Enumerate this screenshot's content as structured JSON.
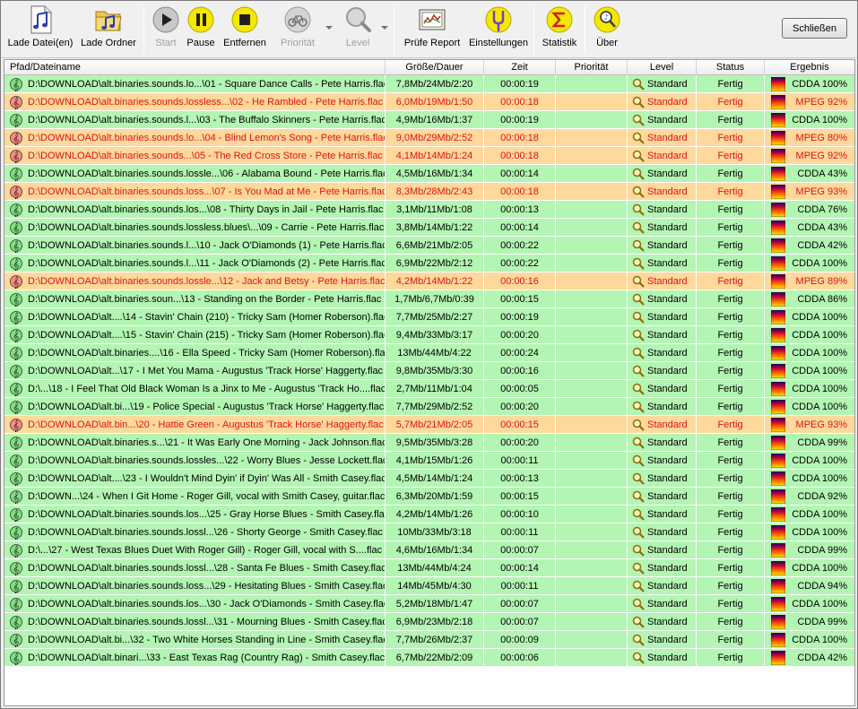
{
  "toolbar": {
    "load_file": "Lade Datei(en)",
    "load_folder": "Lade Ordner",
    "start": "Start",
    "pause": "Pause",
    "remove": "Entfernen",
    "priority": "Priorität",
    "level": "Level",
    "check_report": "Prüfe Report",
    "settings": "Einstellungen",
    "statistics": "Statistik",
    "about": "Über",
    "close": "Schließen"
  },
  "columns": {
    "path": "Pfad/Dateiname",
    "size": "Größe/Dauer",
    "time": "Zeit",
    "priority": "Priorität",
    "level": "Level",
    "status": "Status",
    "result": "Ergebnis"
  },
  "colors": {
    "ok_row": "#b3f5b3",
    "warn_row": "#ffd99b",
    "warn_text": "#e01010"
  },
  "rows": [
    {
      "path": "D:\\DOWNLOAD\\alt.binaries.sounds.lo...\\01 - Square Dance Calls - Pete Harris.flac",
      "size": "7,8Mb/24Mb/2:20",
      "time": "00:00:19",
      "level": "Standard",
      "status": "Fertig",
      "result": "CDDA 100%",
      "warn": false
    },
    {
      "path": "D:\\DOWNLOAD\\alt.binaries.sounds.lossless...\\02 - He Rambled - Pete Harris.flac",
      "size": "6,0Mb/19Mb/1:50",
      "time": "00:00:18",
      "level": "Standard",
      "status": "Fertig",
      "result": "MPEG 92%",
      "warn": true
    },
    {
      "path": "D:\\DOWNLOAD\\alt.binaries.sounds.l...\\03 - The Buffalo Skinners - Pete Harris.flac",
      "size": "4,9Mb/16Mb/1:37",
      "time": "00:00:19",
      "level": "Standard",
      "status": "Fertig",
      "result": "CDDA 100%",
      "warn": false
    },
    {
      "path": "D:\\DOWNLOAD\\alt.binaries.sounds.lo...\\04 - Blind Lemon's Song - Pete Harris.flac",
      "size": "9,0Mb/29Mb/2:52",
      "time": "00:00:18",
      "level": "Standard",
      "status": "Fertig",
      "result": "MPEG 80%",
      "warn": true
    },
    {
      "path": "D:\\DOWNLOAD\\alt.binaries.sounds...\\05 - The Red Cross Store - Pete Harris.flac",
      "size": "4,1Mb/14Mb/1:24",
      "time": "00:00:18",
      "level": "Standard",
      "status": "Fertig",
      "result": "MPEG 92%",
      "warn": true
    },
    {
      "path": "D:\\DOWNLOAD\\alt.binaries.sounds.lossle...\\06 - Alabama Bound - Pete Harris.flac",
      "size": "4,5Mb/16Mb/1:34",
      "time": "00:00:14",
      "level": "Standard",
      "status": "Fertig",
      "result": "CDDA 43%",
      "warn": false
    },
    {
      "path": "D:\\DOWNLOAD\\alt.binaries.sounds.loss...\\07 - Is You Mad at Me - Pete Harris.flac",
      "size": "8,3Mb/28Mb/2:43",
      "time": "00:00:18",
      "level": "Standard",
      "status": "Fertig",
      "result": "MPEG 93%",
      "warn": true
    },
    {
      "path": "D:\\DOWNLOAD\\alt.binaries.sounds.los...\\08 - Thirty Days in Jail - Pete Harris.flac",
      "size": "3,1Mb/11Mb/1:08",
      "time": "00:00:13",
      "level": "Standard",
      "status": "Fertig",
      "result": "CDDA 76%",
      "warn": false
    },
    {
      "path": "D:\\DOWNLOAD\\alt.binaries.sounds.lossless.blues\\...\\09 - Carrie - Pete Harris.flac",
      "size": "3,8Mb/14Mb/1:22",
      "time": "00:00:14",
      "level": "Standard",
      "status": "Fertig",
      "result": "CDDA 43%",
      "warn": false
    },
    {
      "path": "D:\\DOWNLOAD\\alt.binaries.sounds.l...\\10 - Jack O'Diamonds (1) - Pete Harris.flac",
      "size": "6,6Mb/21Mb/2:05",
      "time": "00:00:22",
      "level": "Standard",
      "status": "Fertig",
      "result": "CDDA 42%",
      "warn": false
    },
    {
      "path": "D:\\DOWNLOAD\\alt.binaries.sounds.l...\\11 - Jack O'Diamonds (2) - Pete Harris.flac",
      "size": "6,9Mb/22Mb/2:12",
      "time": "00:00:22",
      "level": "Standard",
      "status": "Fertig",
      "result": "CDDA 100%",
      "warn": false
    },
    {
      "path": "D:\\DOWNLOAD\\alt.binaries.sounds.lossle...\\12 - Jack and Betsy - Pete Harris.flac",
      "size": "4,2Mb/14Mb/1:22",
      "time": "00:00:16",
      "level": "Standard",
      "status": "Fertig",
      "result": "MPEG 89%",
      "warn": true
    },
    {
      "path": "D:\\DOWNLOAD\\alt.binaries.soun...\\13 - Standing on the Border - Pete Harris.flac",
      "size": "1,7Mb/6,7Mb/0:39",
      "time": "00:00:15",
      "level": "Standard",
      "status": "Fertig",
      "result": "CDDA 86%",
      "warn": false
    },
    {
      "path": "D:\\DOWNLOAD\\alt....\\14 - Stavin' Chain (210) - Tricky Sam (Homer Roberson).flac",
      "size": "7,7Mb/25Mb/2:27",
      "time": "00:00:19",
      "level": "Standard",
      "status": "Fertig",
      "result": "CDDA 100%",
      "warn": false
    },
    {
      "path": "D:\\DOWNLOAD\\alt....\\15 - Stavin' Chain (215) - Tricky Sam (Homer Roberson).flac",
      "size": "9,4Mb/33Mb/3:17",
      "time": "00:00:20",
      "level": "Standard",
      "status": "Fertig",
      "result": "CDDA 100%",
      "warn": false
    },
    {
      "path": "D:\\DOWNLOAD\\alt.binaries....\\16 - Ella Speed - Tricky Sam (Homer Roberson).flac",
      "size": "13Mb/44Mb/4:22",
      "time": "00:00:24",
      "level": "Standard",
      "status": "Fertig",
      "result": "CDDA 100%",
      "warn": false
    },
    {
      "path": "D:\\DOWNLOAD\\alt...\\17 - I Met You Mama - Augustus 'Track Horse' Haggerty.flac",
      "size": "9,8Mb/35Mb/3:30",
      "time": "00:00:16",
      "level": "Standard",
      "status": "Fertig",
      "result": "CDDA 100%",
      "warn": false
    },
    {
      "path": "D:\\...\\18 - I Feel That Old Black Woman Is a Jinx to Me - Augustus 'Track Ho....flac",
      "size": "2,7Mb/11Mb/1:04",
      "time": "00:00:05",
      "level": "Standard",
      "status": "Fertig",
      "result": "CDDA 100%",
      "warn": false
    },
    {
      "path": "D:\\DOWNLOAD\\alt.bi...\\19 - Police Special - Augustus 'Track Horse' Haggerty.flac",
      "size": "7,7Mb/29Mb/2:52",
      "time": "00:00:20",
      "level": "Standard",
      "status": "Fertig",
      "result": "CDDA 100%",
      "warn": false
    },
    {
      "path": "D:\\DOWNLOAD\\alt.bin...\\20 - Hattie Green - Augustus 'Track Horse' Haggerty.flac",
      "size": "5,7Mb/21Mb/2:05",
      "time": "00:00:15",
      "level": "Standard",
      "status": "Fertig",
      "result": "MPEG 93%",
      "warn": true
    },
    {
      "path": "D:\\DOWNLOAD\\alt.binaries.s...\\21 - It Was Early One Morning - Jack Johnson.flac",
      "size": "9,5Mb/35Mb/3:28",
      "time": "00:00:20",
      "level": "Standard",
      "status": "Fertig",
      "result": "CDDA 99%",
      "warn": false
    },
    {
      "path": "D:\\DOWNLOAD\\alt.binaries.sounds.lossles...\\22 - Worry Blues - Jesse Lockett.flac",
      "size": "4,1Mb/15Mb/1:26",
      "time": "00:00:11",
      "level": "Standard",
      "status": "Fertig",
      "result": "CDDA 100%",
      "warn": false
    },
    {
      "path": "D:\\DOWNLOAD\\alt....\\23 - I Wouldn't Mind Dyin' if Dyin' Was All - Smith Casey.flac",
      "size": "4,5Mb/14Mb/1:24",
      "time": "00:00:13",
      "level": "Standard",
      "status": "Fertig",
      "result": "CDDA 100%",
      "warn": false
    },
    {
      "path": "D:\\DOWN...\\24 - When I Git Home - Roger Gill, vocal with Smith Casey, guitar.flac",
      "size": "6,3Mb/20Mb/1:59",
      "time": "00:00:15",
      "level": "Standard",
      "status": "Fertig",
      "result": "CDDA 92%",
      "warn": false
    },
    {
      "path": "D:\\DOWNLOAD\\alt.binaries.sounds.los...\\25 - Gray Horse Blues - Smith Casey.flac",
      "size": "4,2Mb/14Mb/1:26",
      "time": "00:00:10",
      "level": "Standard",
      "status": "Fertig",
      "result": "CDDA 100%",
      "warn": false
    },
    {
      "path": "D:\\DOWNLOAD\\alt.binaries.sounds.lossl...\\26 - Shorty George - Smith Casey.flac",
      "size": "10Mb/33Mb/3:18",
      "time": "00:00:11",
      "level": "Standard",
      "status": "Fertig",
      "result": "CDDA 100%",
      "warn": false
    },
    {
      "path": "D:\\...\\27 - West Texas Blues Duet With Roger Gill) - Roger Gill, vocal with S....flac",
      "size": "4,6Mb/16Mb/1:34",
      "time": "00:00:07",
      "level": "Standard",
      "status": "Fertig",
      "result": "CDDA 99%",
      "warn": false
    },
    {
      "path": "D:\\DOWNLOAD\\alt.binaries.sounds.lossl...\\28 - Santa Fe Blues - Smith Casey.flac",
      "size": "13Mb/44Mb/4:24",
      "time": "00:00:14",
      "level": "Standard",
      "status": "Fertig",
      "result": "CDDA 100%",
      "warn": false
    },
    {
      "path": "D:\\DOWNLOAD\\alt.binaries.sounds.loss...\\29 - Hesitating Blues - Smith Casey.flac",
      "size": "14Mb/45Mb/4:30",
      "time": "00:00:11",
      "level": "Standard",
      "status": "Fertig",
      "result": "CDDA 94%",
      "warn": false
    },
    {
      "path": "D:\\DOWNLOAD\\alt.binaries.sounds.los...\\30 - Jack O'Diamonds - Smith Casey.flac",
      "size": "5,2Mb/18Mb/1:47",
      "time": "00:00:07",
      "level": "Standard",
      "status": "Fertig",
      "result": "CDDA 100%",
      "warn": false
    },
    {
      "path": "D:\\DOWNLOAD\\alt.binaries.sounds.lossl...\\31 - Mourning Blues - Smith Casey.flac",
      "size": "6,9Mb/23Mb/2:18",
      "time": "00:00:07",
      "level": "Standard",
      "status": "Fertig",
      "result": "CDDA 99%",
      "warn": false
    },
    {
      "path": "D:\\DOWNLOAD\\alt.bi...\\32 - Two White Horses Standing in Line - Smith Casey.flac",
      "size": "7,7Mb/26Mb/2:37",
      "time": "00:00:09",
      "level": "Standard",
      "status": "Fertig",
      "result": "CDDA 100%",
      "warn": false
    },
    {
      "path": "D:\\DOWNLOAD\\alt.binari...\\33 - East Texas Rag (Country Rag) - Smith Casey.flac",
      "size": "6,7Mb/22Mb/2:09",
      "time": "00:00:06",
      "level": "Standard",
      "status": "Fertig",
      "result": "CDDA 42%",
      "warn": false
    }
  ]
}
